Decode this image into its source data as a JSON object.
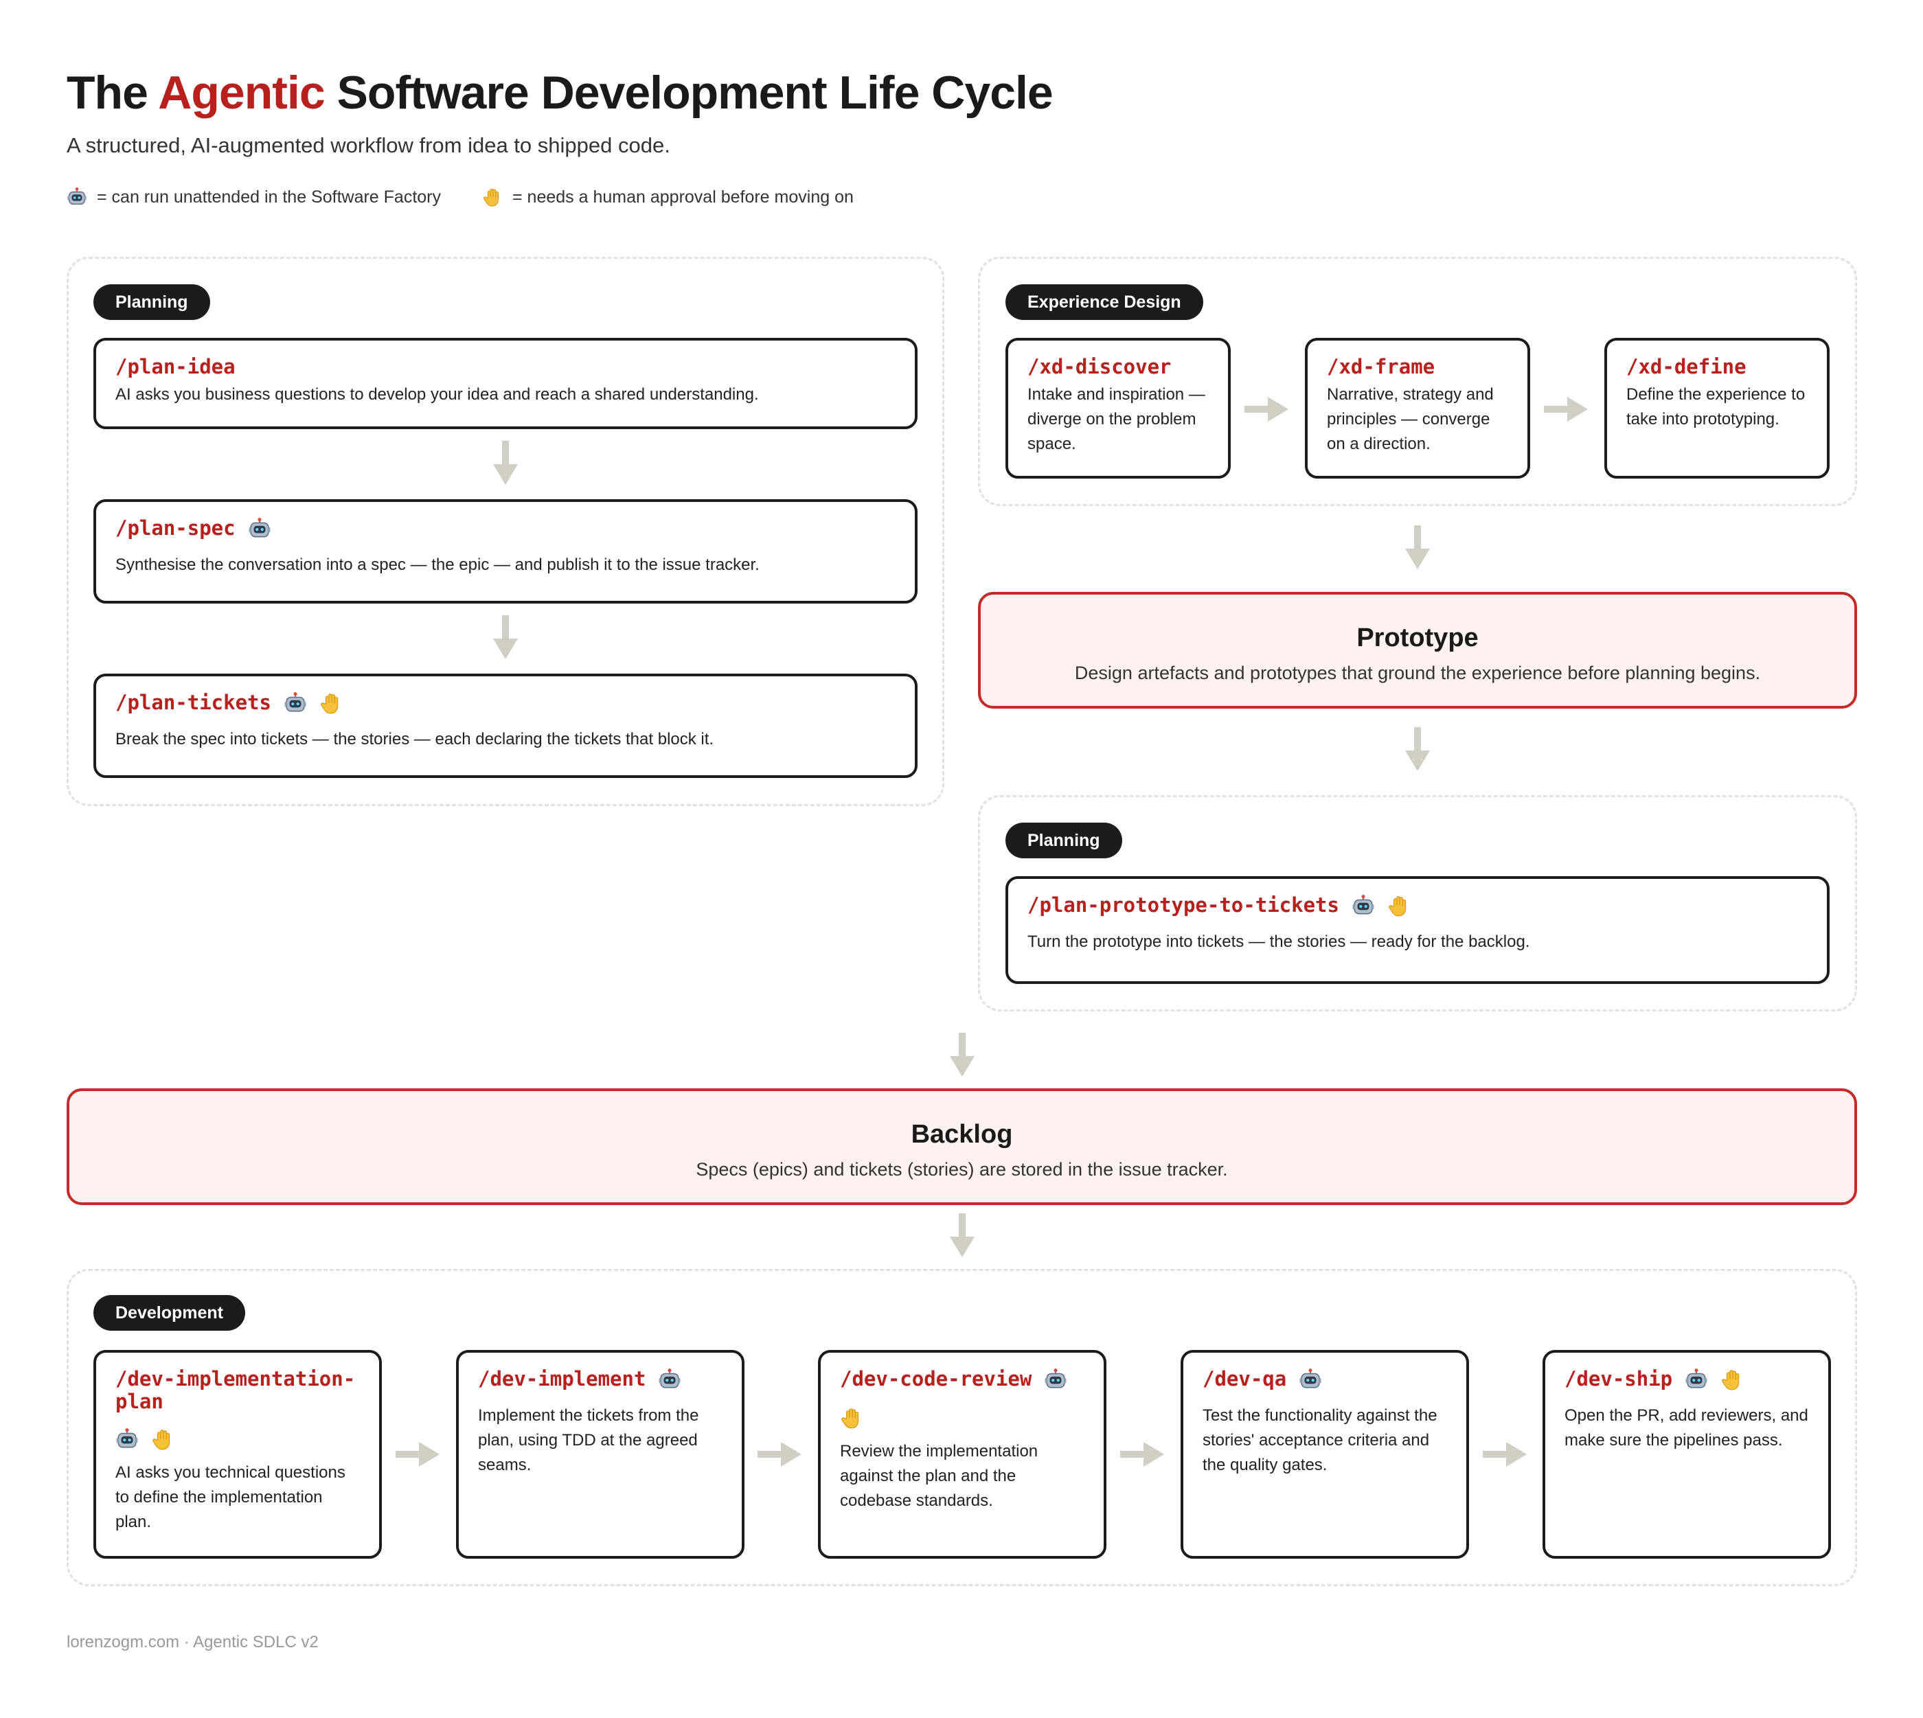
{
  "header": {
    "title_prefix": "The",
    "title_accent": "Agentic",
    "title_suffix": "Software Development Life Cycle",
    "subtitle": "A structured, AI-augmented workflow from idea to shipped code.",
    "legend": {
      "robot_text": "= can run unattended in the Software Factory",
      "hand_text": "= needs a human approval before moving on"
    }
  },
  "planning": {
    "label": "Planning",
    "cards": [
      {
        "cmd": "/plan-idea",
        "desc": "AI asks you business questions to develop your idea and reach a shared understanding.",
        "icons": []
      },
      {
        "cmd": "/plan-spec",
        "desc": "Synthesise the conversation into a spec — the epic — and publish it to the issue tracker.",
        "icons": [
          "robot-icon"
        ]
      },
      {
        "cmd": "/plan-tickets",
        "desc": "Break the spec into tickets — the stories — each declaring the tickets that block it.",
        "icons": [
          "robot-icon",
          "hand-icon"
        ]
      }
    ]
  },
  "experience_design": {
    "label": "Experience Design",
    "cards": [
      {
        "cmd": "/xd-discover",
        "desc": "Intake and inspiration — diverge on the problem space."
      },
      {
        "cmd": "/xd-frame",
        "desc": "Narrative, strategy and principles — converge on a direction."
      },
      {
        "cmd": "/xd-define",
        "desc": "Define the experience to take into prototyping."
      }
    ]
  },
  "prototype": {
    "title": "Prototype",
    "desc": "Design artefacts and prototypes that ground the experience before planning begins."
  },
  "planning_from_prototype": {
    "label": "Planning",
    "card": {
      "cmd": "/plan-prototype-to-tickets",
      "desc": "Turn the prototype into tickets — the stories — ready for the backlog.",
      "icons": [
        "robot-icon",
        "hand-icon"
      ]
    }
  },
  "backlog": {
    "title": "Backlog",
    "desc": "Specs (epics) and tickets (stories) are stored in the issue tracker."
  },
  "development": {
    "label": "Development",
    "cards": [
      {
        "cmd": "/dev-implementation-plan",
        "desc": "AI asks you technical questions to define the implementation plan.",
        "icons": [
          "robot-icon",
          "hand-icon"
        ]
      },
      {
        "cmd": "/dev-implement",
        "desc": "Implement the tickets from the plan, using TDD at the agreed seams.",
        "icons": [
          "robot-icon"
        ]
      },
      {
        "cmd": "/dev-code-review",
        "desc": "Review the implementation against the plan and the codebase standards.",
        "icons": [
          "robot-icon",
          "hand-icon"
        ]
      },
      {
        "cmd": "/dev-qa",
        "desc": "Test the functionality against the stories' acceptance criteria and the quality gates.",
        "icons": [
          "robot-icon"
        ]
      },
      {
        "cmd": "/dev-ship",
        "desc": "Open the PR, add reviewers, and make sure the pipelines pass.",
        "icons": [
          "robot-icon",
          "hand-icon"
        ]
      }
    ]
  },
  "footer": {
    "text": "lorenzogm.com · Agentic SDLC v2"
  }
}
